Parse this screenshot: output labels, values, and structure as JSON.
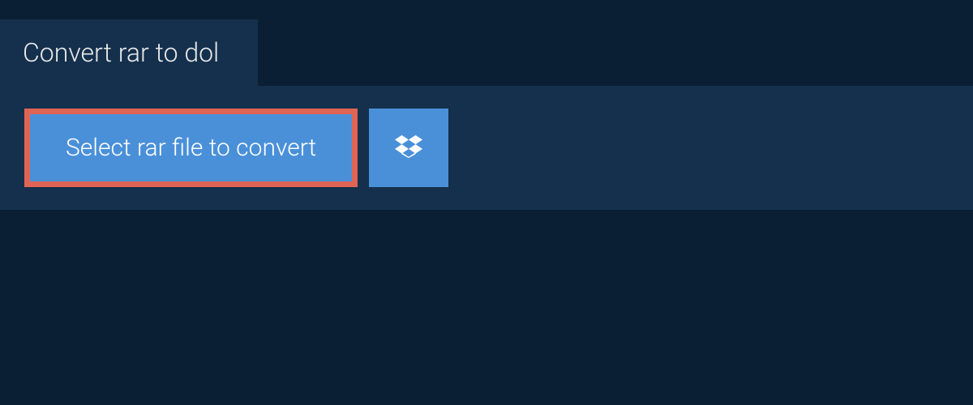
{
  "tab": {
    "title": "Convert rar to dol"
  },
  "actions": {
    "select_file_label": "Select rar file to convert"
  }
}
